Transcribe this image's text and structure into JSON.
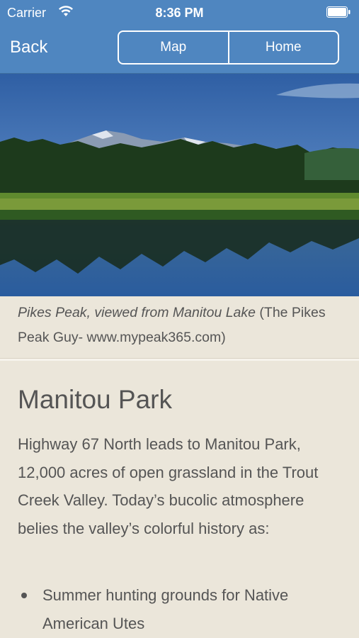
{
  "status_bar": {
    "carrier": "Carrier",
    "time": "8:36 PM"
  },
  "nav": {
    "back_label": "Back",
    "segments": [
      "Map",
      "Home"
    ]
  },
  "photo": {
    "caption_italic": "Pikes Peak, viewed from Manitou Lake",
    "caption_credit": " (The Pikes Peak Guy- www.mypeak365.com)"
  },
  "article": {
    "title": "Manitou Park",
    "paragraph": "Highway 67 North leads to Manitou Park, 12,000 acres of open grassland in the Trout Creek Valley. Today’s bucolic atmosphere belies the valley’s colorful history as:",
    "bullets": [
      "Summer hunting grounds for Native American Utes"
    ]
  },
  "colors": {
    "header_blue": "#4f86c0",
    "page_background": "#ebe6da",
    "text": "#555555"
  }
}
